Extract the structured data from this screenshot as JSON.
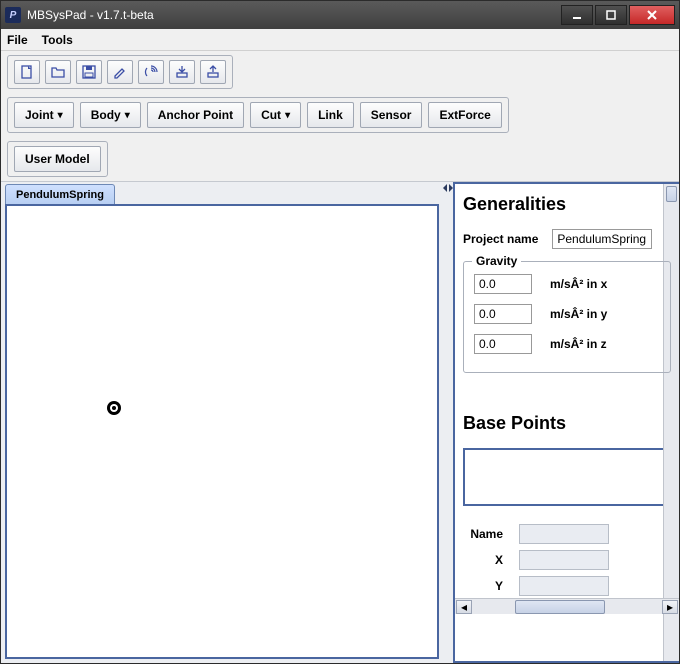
{
  "window": {
    "title": "MBSysPad - v1.7.t-beta"
  },
  "menubar": {
    "file": "File",
    "tools": "Tools"
  },
  "toolbar2": {
    "joint": "Joint",
    "body": "Body",
    "anchor": "Anchor Point",
    "cut": "Cut",
    "link": "Link",
    "sensor": "Sensor",
    "extforce": "ExtForce"
  },
  "toolbar3": {
    "usermodel": "User Model"
  },
  "tabs": {
    "active": "PendulumSpring"
  },
  "panel": {
    "generalities_heading": "Generalities",
    "project_name_label": "Project name",
    "project_name_value": "PendulumSpring",
    "gravity_legend": "Gravity",
    "gravity": {
      "x": "0.0",
      "y": "0.0",
      "z": "0.0",
      "unit_x": "m/sÂ² in x",
      "unit_y": "m/sÂ² in y",
      "unit_z": "m/sÂ² in z"
    },
    "basepoints_heading": "Base Points",
    "bp_name_label": "Name",
    "bp_x_label": "X",
    "bp_y_label": "Y"
  }
}
